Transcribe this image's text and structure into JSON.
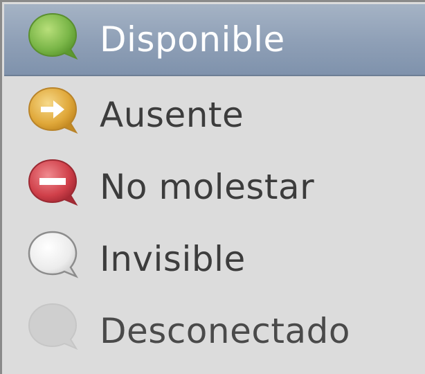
{
  "status_menu": {
    "items": [
      {
        "label": "Disponible",
        "icon": "available-icon",
        "selected": true
      },
      {
        "label": "Ausente",
        "icon": "away-icon",
        "selected": false
      },
      {
        "label": "No molestar",
        "icon": "busy-icon",
        "selected": false
      },
      {
        "label": "Invisible",
        "icon": "invisible-icon",
        "selected": false
      },
      {
        "label": "Desconectado",
        "icon": "offline-icon",
        "selected": false
      }
    ]
  },
  "colors": {
    "selection": "#8e9fb6",
    "available": "#7ab648",
    "away": "#e0a83a",
    "busy": "#d0404a",
    "invisible": "#e6e6e6",
    "offline": "#cfcfcf"
  }
}
